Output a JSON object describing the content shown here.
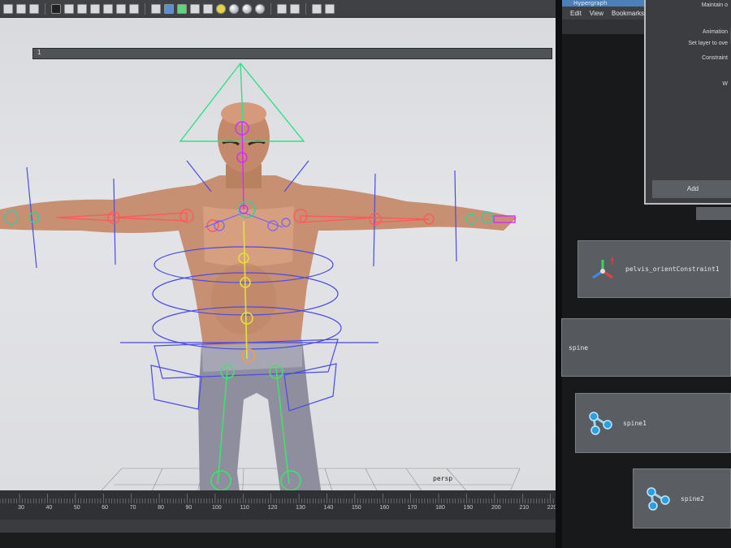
{
  "toolbar": {
    "icons": [
      "select-icon",
      "lasso-icon",
      "paint-icon",
      "grid-icon",
      "layers-icon",
      "render-icon",
      "wire-icon",
      "smooth-icon",
      "texture-icon",
      "text-icon",
      "cube-icon",
      "camera-icon",
      "joint-icon",
      "xray-icon",
      "light-icon",
      "sphere-icon",
      "shadow-icon",
      "ao-icon",
      "aa-icon",
      "dof-icon",
      "isolate-icon",
      "isolate2-icon",
      "share-icon"
    ]
  },
  "viewport": {
    "camera_label": "persp",
    "colors": {
      "background": "#dcdde0",
      "skeleton_spine": "#e0e040",
      "skeleton_arm": "#ff5a5a",
      "ik_handle": "#2fe08a",
      "control_curve": "#4a4ae8",
      "aim_locator": "#d22cff"
    }
  },
  "timeline": {
    "ticks": [
      "30",
      "40",
      "50",
      "60",
      "70",
      "80",
      "90",
      "100",
      "110",
      "120",
      "130",
      "140",
      "150",
      "160",
      "170",
      "180",
      "190",
      "200",
      "210",
      "220"
    ],
    "range_start": "1"
  },
  "hypergraph": {
    "title": "Hypergraph",
    "menu": [
      "Edit",
      "View",
      "Bookmarks"
    ],
    "nodes": {
      "pelvis": "pelvis_orientConstraint1",
      "spine": "spine",
      "spine1": "spine1",
      "spine2": "spine2"
    }
  },
  "attribute_panel": {
    "lines": [
      "Maintain o",
      "Animation",
      "Set layer to ove",
      "Constraint",
      "W"
    ],
    "add_label": "Add"
  }
}
